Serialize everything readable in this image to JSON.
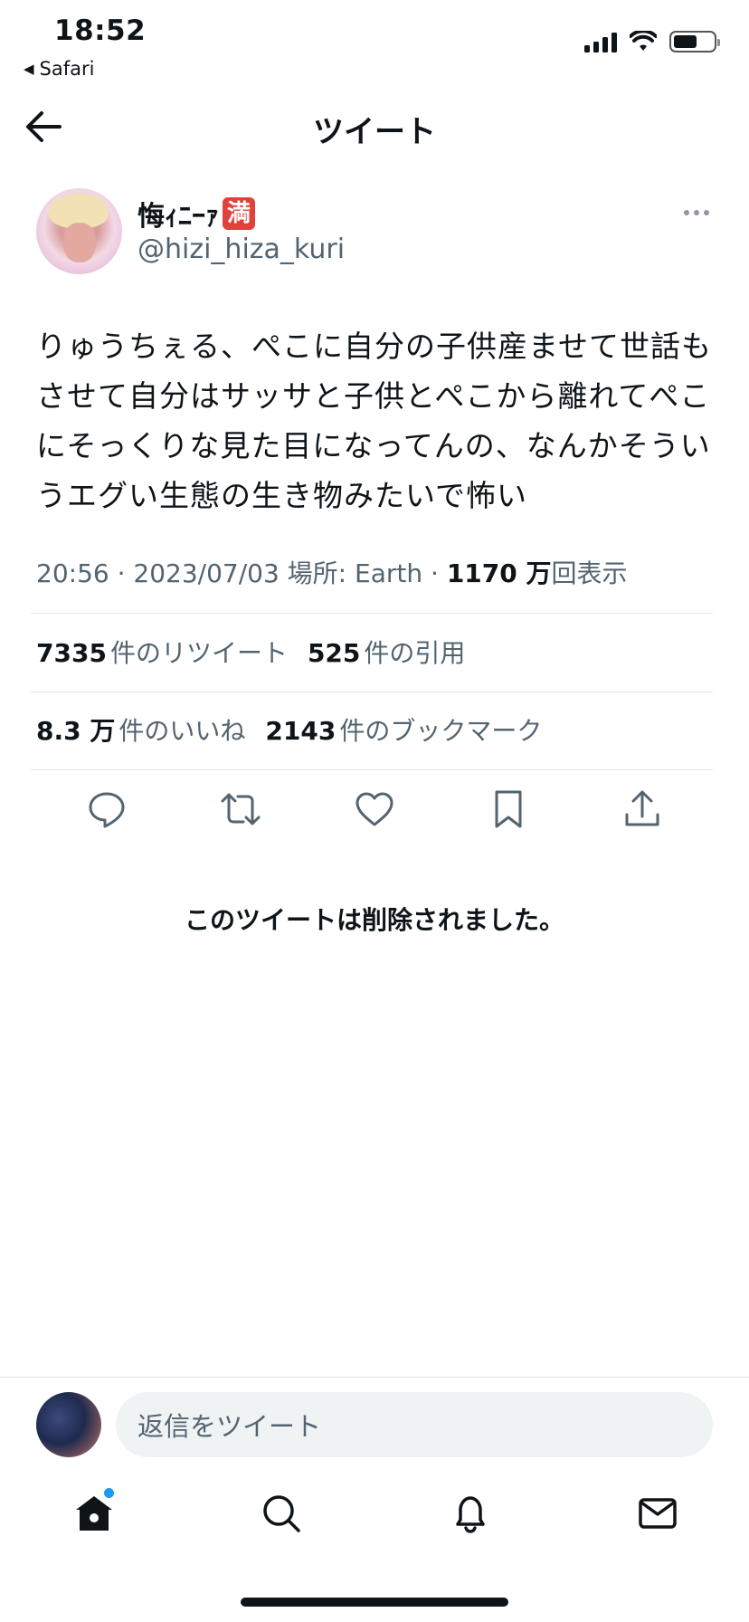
{
  "status_bar": {
    "time": "18:52",
    "back_app": "Safari",
    "battery_level": 0.6
  },
  "header": {
    "title": "ツイート",
    "back_icon": "arrow-left-icon"
  },
  "tweet": {
    "author_name": "悔ｨﾆｰｧ",
    "author_badge": "満",
    "author_handle": "@hizi_hiza_kuri",
    "text": "りゅうちぇる、ぺこに自分の子供産ませて世話もさせて自分はサッサと子供とぺこから離れてぺこにそっくりな見た目になってんの、なんかそういうエグい生態の生き物みたいで怖い",
    "meta_prefix": "20:56 · 2023/07/03 場所: Earth · ",
    "views_count": "1170 万",
    "views_label": "回表示",
    "retweets_count": "7335",
    "retweets_label": "件のリツイート",
    "quotes_count": "525",
    "quotes_label": "件の引用",
    "likes_count": "8.3 万",
    "likes_label": "件のいいね",
    "bookmarks_count": "2143",
    "bookmarks_label": "件のブックマーク"
  },
  "actions": [
    "reply-icon",
    "retweet-icon",
    "like-icon",
    "bookmark-icon",
    "share-icon"
  ],
  "deleted_notice": "このツイートは削除されました。",
  "reply": {
    "placeholder": "返信をツイート"
  },
  "tabs": [
    "home-icon",
    "search-icon",
    "notifications-icon",
    "messages-icon"
  ],
  "colors": {
    "text": "#0f1419",
    "secondary": "#536471",
    "accent": "#1d9bf0",
    "divider": "#e1e4e8",
    "badge": "#e0413a"
  }
}
